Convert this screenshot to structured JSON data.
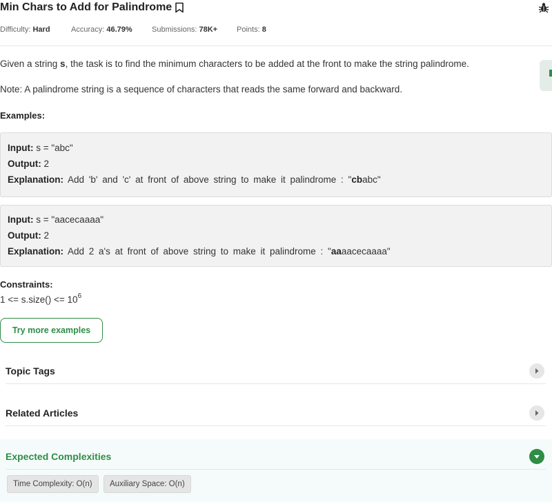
{
  "problem": {
    "title": "Min Chars to Add for Palindrome",
    "meta": {
      "difficulty_label": "Difficulty:",
      "difficulty_value": "Hard",
      "accuracy_label": "Accuracy:",
      "accuracy_value": "46.79%",
      "submissions_label": "Submissions:",
      "submissions_value": "78K+",
      "points_label": "Points:",
      "points_value": "8"
    },
    "description_before": "Given a string ",
    "description_var": "s",
    "description_after": ", the task is to find the minimum characters to be added at the front to make the string palindrome.",
    "note": "Note: A palindrome string is a sequence of characters that reads the same forward and backward.",
    "examples_heading": "Examples:",
    "examples": [
      {
        "input_label": "Input:",
        "input_value": " s = \"abc\"",
        "output_label": "Output:",
        "output_value": " 2",
        "explanation_label": "Explanation:",
        "explanation_text": " Add 'b' and 'c' at front of above string to make it palindrome : \"",
        "explanation_bold": "cb",
        "explanation_tail": "abc\""
      },
      {
        "input_label": "Input:",
        "input_value": " s = \"aacecaaaa\"",
        "output_label": "Output:",
        "output_value": " 2",
        "explanation_label": "Explanation:",
        "explanation_text": " Add 2 a's at front of above string to make it palindrome : \"",
        "explanation_bold": "aa",
        "explanation_tail": "aacecaaaa\""
      }
    ],
    "constraints_heading": "Constraints:",
    "constraint_text": "1 <= s.size() <= 10",
    "constraint_exp": "6",
    "try_button": "Try more examples",
    "accordions": {
      "topic_tags": "Topic Tags",
      "related_articles": "Related Articles",
      "expected_complexities": "Expected Complexities"
    },
    "complexities": {
      "time": "Time Complexity: O(n)",
      "space": "Auxiliary Space: O(n)"
    }
  },
  "icons": {
    "bookmark": "bookmark-icon",
    "bug": "bug-icon",
    "arrow_right": "chevron-right-icon",
    "arrow_down": "chevron-down-icon"
  },
  "colors": {
    "accent": "#2f8d46",
    "example_bg": "#f2f2f2",
    "complexities_bg": "#f5fbfb"
  }
}
